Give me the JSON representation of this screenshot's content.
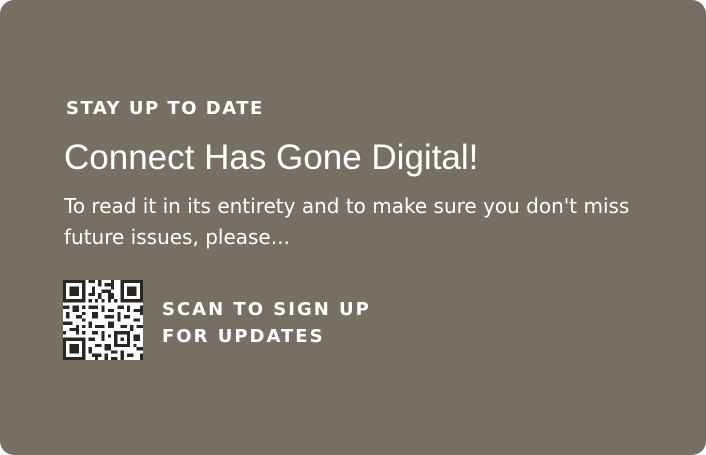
{
  "card": {
    "eyebrow": "STAY UP TO DATE",
    "headline": "Connect Has Gone Digital!",
    "body": "To read it in its entirety and to make sure you don't miss future issues, please...",
    "cta_line_1": "SCAN TO SIGN UP",
    "cta_line_2": "FOR UPDATES",
    "qr_icon": "qr-code-icon"
  },
  "colors": {
    "card_background": "#776f64",
    "text": "#ffffff"
  }
}
